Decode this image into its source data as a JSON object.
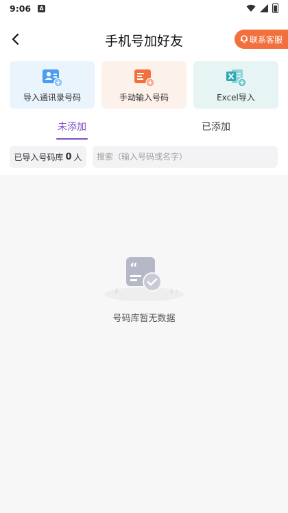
{
  "status_bar": {
    "time": "9:06",
    "notif_icon": "A"
  },
  "header": {
    "title": "手机号加好友",
    "contact_label": "联系客服"
  },
  "actions": [
    {
      "label": "导入通讯录号码",
      "icon": "contact-card-add-icon",
      "color": "#4a9ef0"
    },
    {
      "label": "手动输入号码",
      "icon": "manual-input-icon",
      "color": "#f2703e"
    },
    {
      "label": "Excel导入",
      "icon": "excel-icon",
      "color": "#2fa8b5"
    }
  ],
  "tabs": {
    "active": "未添加",
    "inactive": "已添加",
    "accent": "#7b4fc8"
  },
  "count": {
    "prefix": "已导入号码库",
    "value": "0",
    "suffix": "人"
  },
  "search": {
    "placeholder": "搜索（输入号码或名字）"
  },
  "empty": {
    "text": "号码库暂无数据"
  }
}
